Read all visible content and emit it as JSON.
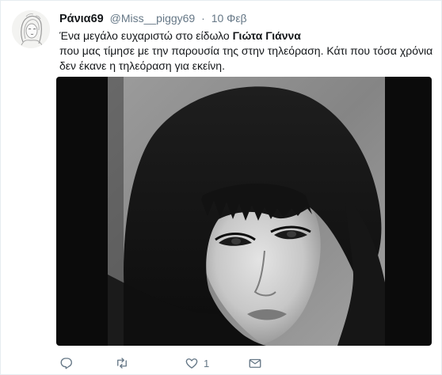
{
  "tweet": {
    "display_name": "Ράνια69",
    "handle": "@Miss__piggy69",
    "separator": "·",
    "date": "10 Φεβ",
    "text_line1_prefix": "Ένα μεγάλο ευχαριστώ στο είδωλο ",
    "text_line1_bold": "Γιώτα Γιάννα",
    "text_line2": "που μας τίμησε με την παρουσία της στην τηλεόραση. Κάτι που τόσα χρόνια",
    "text_line3": "δεν έκανε η τηλεόραση για εκείνη.",
    "actions": {
      "reply": {
        "icon": "reply-icon",
        "count": ""
      },
      "retweet": {
        "icon": "retweet-icon",
        "count": ""
      },
      "like": {
        "icon": "heart-icon",
        "count": "1"
      },
      "dm": {
        "icon": "envelope-icon",
        "count": ""
      }
    }
  },
  "colors": {
    "text": "#14171a",
    "secondary": "#657786",
    "border": "#e6ecf0"
  }
}
